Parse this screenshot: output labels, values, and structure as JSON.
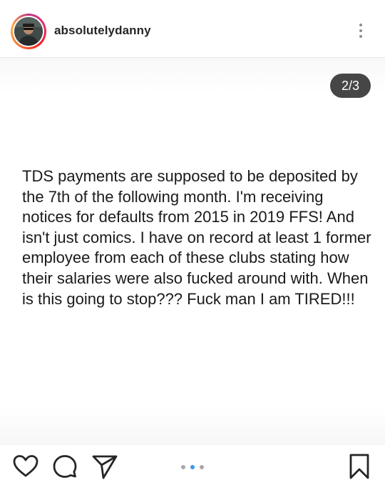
{
  "header": {
    "username": "absolutelydanny",
    "avatar_icon": "profile-photo",
    "more_icon": "vertical-ellipsis-icon"
  },
  "post": {
    "counter": "2/3",
    "caption": "TDS payments are supposed to be deposited by the 7th of the following month. I'm receiving notices for defaults from 2015 in 2019 FFS! And isn't just comics. I have on record at least 1 former employee from each of these clubs stating how their salaries were also fucked around with. When is this going to stop??? Fuck man I am TIRED!!!"
  },
  "actions": {
    "like_icon": "heart-outline-icon",
    "comment_icon": "comment-bubble-icon",
    "share_icon": "paper-plane-icon",
    "save_icon": "bookmark-outline-icon",
    "carousel": {
      "total": 3,
      "active_index": 1,
      "active_color": "#3897f0",
      "inactive_color": "#a8a8a8"
    }
  }
}
